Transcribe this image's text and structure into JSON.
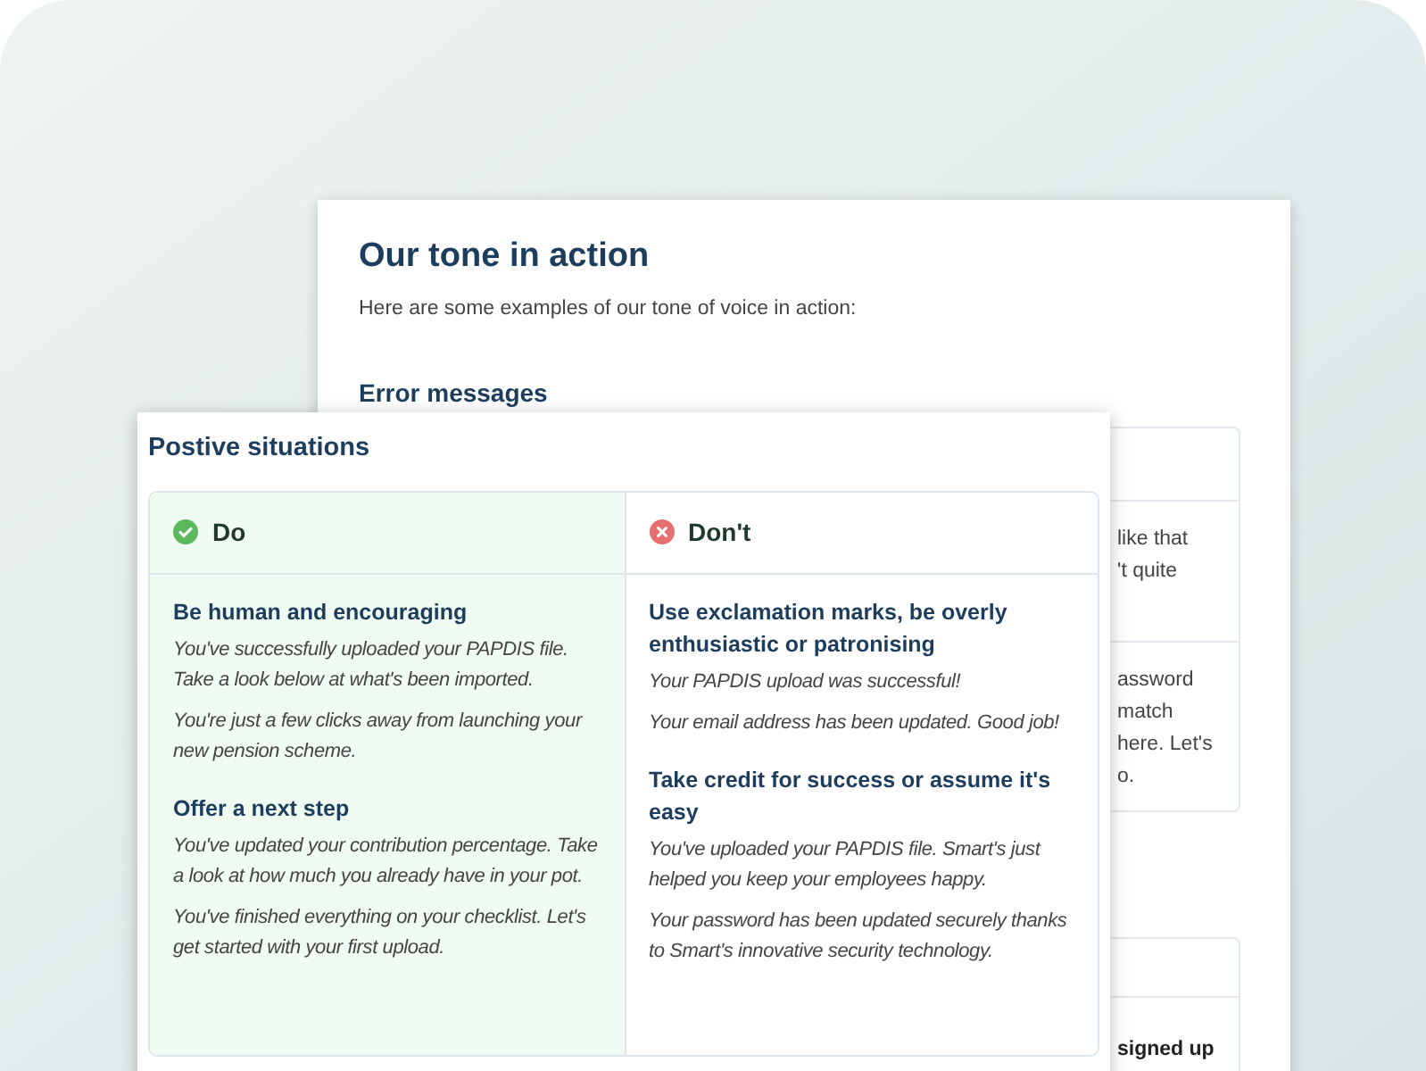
{
  "back_card": {
    "title": "Our tone in action",
    "intro": "Here are some examples of our tone of voice in action:",
    "section": "Error messages",
    "box_rows": [
      {
        "lines": []
      },
      {
        "lines": [
          "like that",
          "'t quite"
        ]
      },
      {
        "lines": [
          "assword",
          "match",
          "here. Let's",
          "o."
        ]
      }
    ],
    "box2_rows": [
      {
        "lines": []
      },
      {
        "lines": [
          "signed up"
        ]
      }
    ]
  },
  "front_card": {
    "title": "Postive situations",
    "columns": [
      {
        "kind": "do",
        "label": "Do",
        "groups": [
          {
            "heading": "Be human and encouraging",
            "examples": [
              "You've successfully uploaded your PAPDIS file. Take a look below at what's been imported.",
              "You're just a few clicks away from launching your new pension scheme."
            ]
          },
          {
            "heading": "Offer a next step",
            "examples": [
              "You've updated your contribution percentage. Take a look at how much you already have in your pot.",
              "You've finished everything on your checklist. Let's get started with your first upload."
            ]
          }
        ]
      },
      {
        "kind": "dont",
        "label": "Don't",
        "groups": [
          {
            "heading": "Use exclamation marks, be overly enthusiastic or patronising",
            "examples": [
              "Your PAPDIS upload was successful!",
              "Your email address has been updated. Good job!"
            ]
          },
          {
            "heading": "Take credit for success or assume it's easy",
            "examples": [
              "You've uploaded your PAPDIS file. Smart's just helped you keep your employees happy.",
              "Your password has been updated securely thanks to Smart's innovative security technology."
            ]
          }
        ]
      }
    ]
  }
}
